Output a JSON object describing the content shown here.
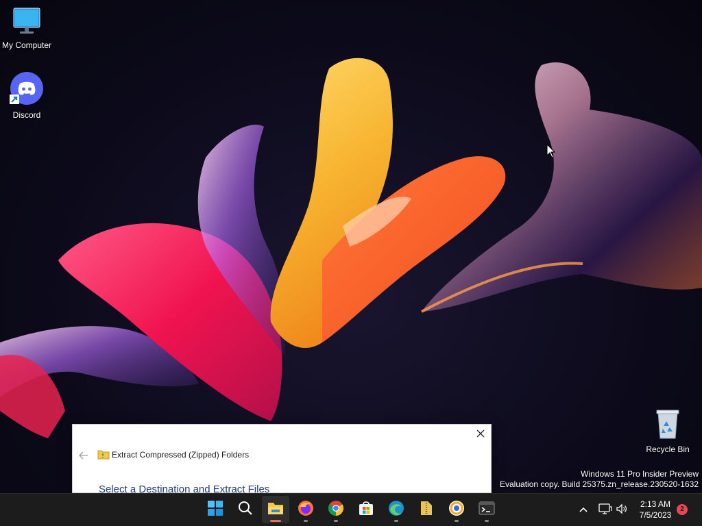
{
  "desktop": {
    "icons": [
      {
        "label": "My Computer",
        "icon": "monitor-icon"
      },
      {
        "label": "Discord",
        "icon": "discord-icon"
      },
      {
        "label": "Recycle Bin",
        "icon": "recycle-bin-icon"
      }
    ],
    "watermark": {
      "line1": "Windows 11 Pro Insider Preview",
      "line2": "Evaluation copy. Build 25375.zn_release.230520-1632"
    }
  },
  "dialog": {
    "title": "Extract Compressed (Zipped) Folders",
    "heading": "Select a Destination and Extract Files",
    "close_icon": "close-icon",
    "back_icon": "back-arrow-icon",
    "heading_color": "#1e3b7a"
  },
  "taskbar": {
    "apps": [
      {
        "name": "Start",
        "icon": "windows-start-icon"
      },
      {
        "name": "Search",
        "icon": "search-icon"
      },
      {
        "name": "File Explorer",
        "icon": "file-explorer-icon",
        "active": true
      },
      {
        "name": "Firefox",
        "icon": "firefox-icon"
      },
      {
        "name": "Chrome",
        "icon": "chrome-icon"
      },
      {
        "name": "Microsoft Store",
        "icon": "store-icon"
      },
      {
        "name": "Edge",
        "icon": "edge-icon"
      },
      {
        "name": "Archive Folder",
        "icon": "zip-folder-icon"
      },
      {
        "name": "Chromium Browser",
        "icon": "browser-icon"
      },
      {
        "name": "Terminal",
        "icon": "terminal-icon"
      }
    ],
    "accent_color": "#e0734a",
    "tray": {
      "time": "2:13 AM",
      "date": "7/5/2023",
      "notification_count": "2"
    }
  }
}
